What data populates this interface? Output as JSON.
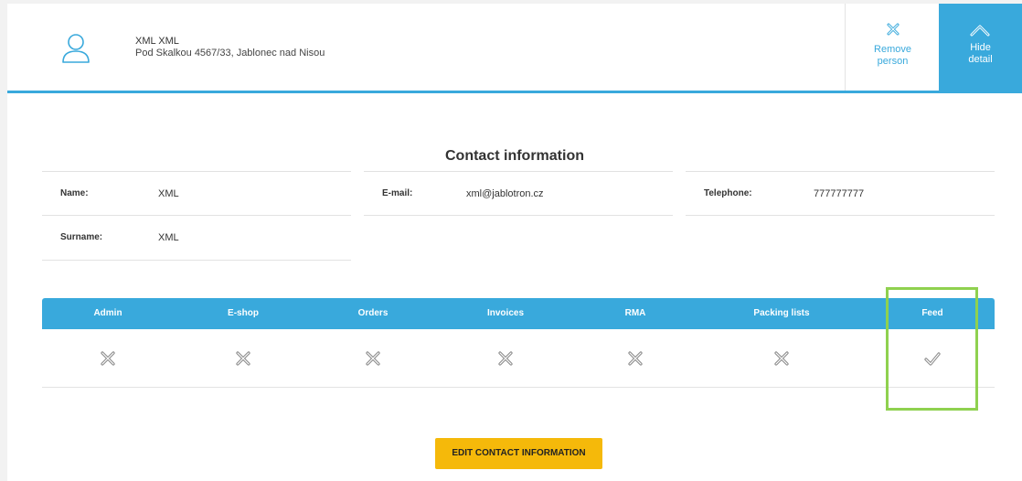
{
  "header": {
    "person_name": "XML XML",
    "person_address": "Pod Skalkou 4567/33, Jablonec nad Nisou",
    "remove_label_line1": "Remove",
    "remove_label_line2": "person",
    "hide_label_line1": "Hide",
    "hide_label_line2": "detail"
  },
  "contact": {
    "title": "Contact information",
    "name_label": "Name:",
    "name_value": "XML",
    "email_label": "E-mail:",
    "email_value": "xml@jablotron.cz",
    "telephone_label": "Telephone:",
    "telephone_value": "777777777",
    "surname_label": "Surname:",
    "surname_value": "XML"
  },
  "permissions": {
    "columns": [
      "Admin",
      "E-shop",
      "Orders",
      "Invoices",
      "RMA",
      "Packing lists",
      "Feed"
    ],
    "values": [
      "denied",
      "denied",
      "denied",
      "denied",
      "denied",
      "denied",
      "granted"
    ]
  },
  "actions": {
    "edit_label": "EDIT CONTACT INFORMATION"
  },
  "colors": {
    "accent": "#39a9dc",
    "button": "#f5b90a",
    "highlight": "#8fd14f"
  }
}
